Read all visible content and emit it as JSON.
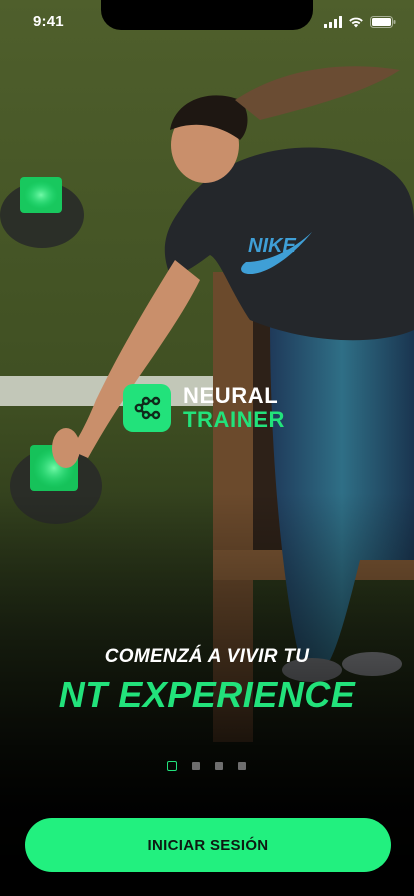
{
  "status_bar": {
    "time": "9:41"
  },
  "brand": {
    "line1": "NEURAL",
    "line2": "TRAINER",
    "accent": "#22e27b"
  },
  "headline": {
    "sub": "COMENZÁ A VIVIR TU",
    "main": "NT EXPERIENCE"
  },
  "pager": {
    "total": 4,
    "active": 1
  },
  "actions": {
    "login_label": "INICIAR SESIÓN"
  },
  "icons": [
    "signal-icon",
    "wifi-icon",
    "battery-icon",
    "neural-trainer-logo-icon"
  ]
}
